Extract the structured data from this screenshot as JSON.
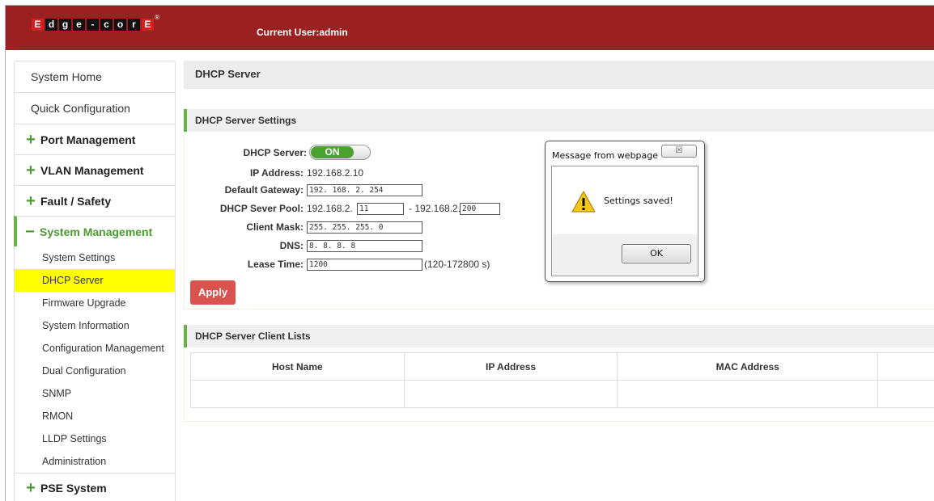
{
  "header": {
    "logo_letters": [
      "E",
      "d",
      "g",
      "e",
      "-",
      "c",
      "o",
      "r",
      "E"
    ],
    "logo_reg": "®",
    "current_user": "Current User:admin"
  },
  "sidebar": {
    "top_items": [
      "System Home",
      "Quick Configuration"
    ],
    "groups": [
      {
        "label": "Port Management",
        "sign": "+"
      },
      {
        "label": "VLAN Management",
        "sign": "+"
      },
      {
        "label": "Fault / Safety",
        "sign": "+"
      },
      {
        "label": "System Management",
        "sign": "−"
      }
    ],
    "sub_items": [
      "System Settings",
      "DHCP Server",
      "Firmware Upgrade",
      "System Information",
      "Configuration Management",
      "Dual Configuration",
      "SNMP",
      "RMON",
      "LLDP Settings",
      "Administration"
    ],
    "selected_sub_item": "DHCP Server",
    "last_group": {
      "label": "PSE System",
      "sign": "+"
    }
  },
  "page": {
    "title": "DHCP Server",
    "settings_section": "DHCP Server Settings",
    "clients_section": "DHCP Server Client Lists"
  },
  "form": {
    "dhcp_server_label": "DHCP Server:",
    "dhcp_server_state": "ON",
    "ip_address_label": "IP Address:",
    "ip_address_value": "192.168.2.10",
    "gateway_label": "Default Gateway:",
    "gateway_value": "192. 168. 2. 254",
    "pool_label": "DHCP Sever Pool:",
    "pool_prefix": "192.168.2.",
    "pool_start": "11",
    "pool_sep": "- 192.168.2.",
    "pool_end": "200",
    "mask_label": "Client Mask:",
    "mask_value": "255. 255. 255. 0",
    "dns_label": "DNS:",
    "dns_value": "8. 8. 8. 8",
    "lease_label": "Lease Time:",
    "lease_value": "1200",
    "lease_hint": "(120-172800 s)",
    "apply_label": "Apply"
  },
  "clients_table": {
    "columns": [
      "Host Name",
      "IP Address",
      "MAC Address",
      ""
    ],
    "rows": []
  },
  "dialog": {
    "title": "Message from webpage",
    "close_glyph": "☒",
    "message": "Settings saved!",
    "ok_label": "OK"
  },
  "colors": {
    "header_bg": "#9b2021",
    "accent_green": "#67b346",
    "apply_red": "#d9534f",
    "selected_yellow": "#ffff00"
  }
}
